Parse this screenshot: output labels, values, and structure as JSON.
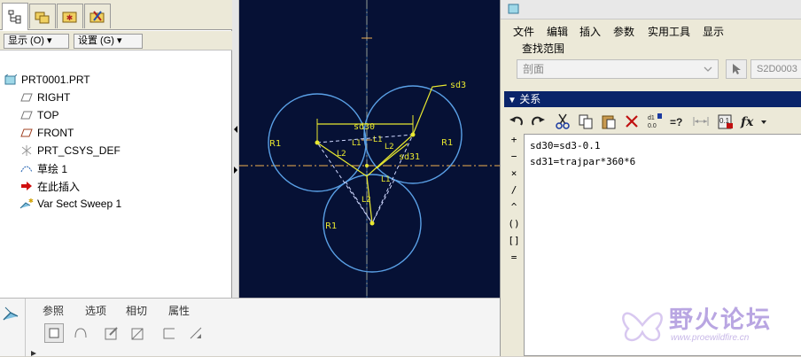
{
  "model_tree": {
    "show_button": "显示 (O) ▾",
    "settings_button": "设置 (G) ▾",
    "items": [
      {
        "label": "PRT0001.PRT"
      },
      {
        "label": "RIGHT"
      },
      {
        "label": "TOP"
      },
      {
        "label": "FRONT"
      },
      {
        "label": "PRT_CSYS_DEF"
      },
      {
        "label": "草绘 1"
      },
      {
        "label": "在此插入"
      },
      {
        "label": "Var Sect Sweep 1"
      }
    ]
  },
  "sketch": {
    "dims": {
      "sd3": "sd3",
      "sd30": "sd30",
      "sd31": "sd31",
      "r1a": "R1",
      "r1b": "R1",
      "r1c": "R1",
      "l1a": "L1",
      "l1b": "L1",
      "l1c": "L1",
      "l2a": "L2",
      "l2b": "L2",
      "l2c": "L2"
    },
    "colors": {
      "background": "#061135",
      "circle": "#5aa0e6",
      "dimension": "#e8e830",
      "axis": "#f0b050"
    }
  },
  "dashboard": {
    "tabs": [
      "参照",
      "选项",
      "相切",
      "属性"
    ]
  },
  "relations_dialog": {
    "menus": [
      "文件",
      "编辑",
      "插入",
      "参数",
      "实用工具",
      "显示"
    ],
    "search_scope_label": "查找范围",
    "search_scope_value": "剖面",
    "search_item_value": "S2D0003",
    "section_title": "关系",
    "operators": [
      "+",
      "−",
      "×",
      "/",
      "^",
      "()",
      "[]",
      "="
    ],
    "relations": [
      "sd30=sd3-0.1",
      "sd31=trajpar*360*6"
    ]
  },
  "watermark": {
    "title": "野火论坛",
    "url": "www.proewildfire.cn"
  }
}
